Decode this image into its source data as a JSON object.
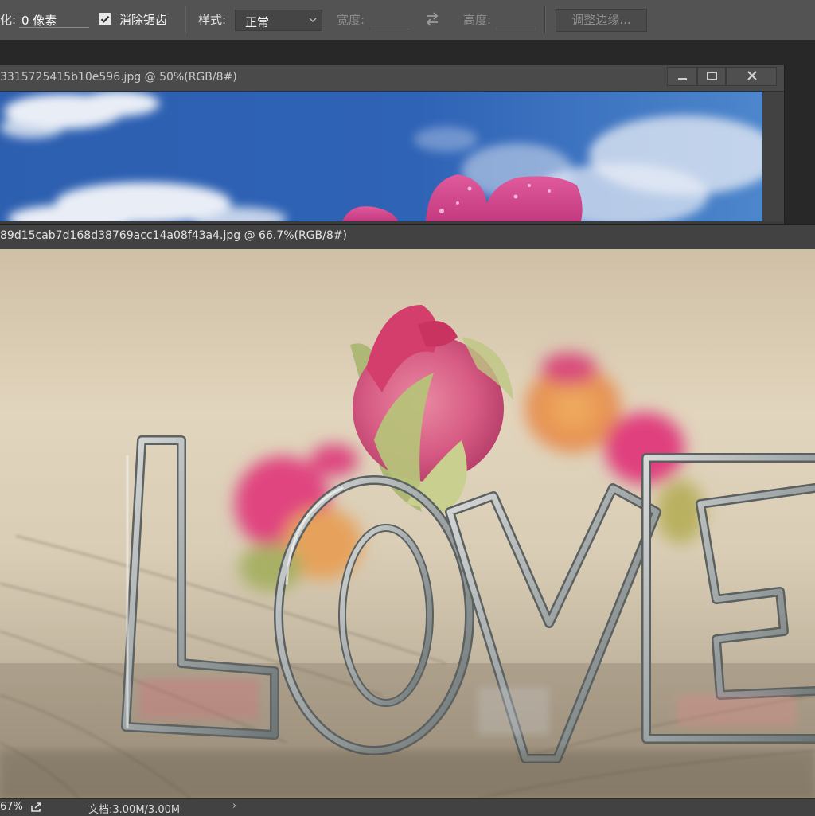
{
  "options_bar": {
    "feather_label": "化:",
    "feather_value": "0 像素",
    "antialias_checked": true,
    "antialias_label": "消除锯齿",
    "style_label": "样式:",
    "style_value": "正常",
    "width_label": "宽度:",
    "height_label": "高度:",
    "refine_edge_label": "调整边缘..."
  },
  "documents": [
    {
      "title": "3315725415b10e596.jpg @ 50%(RGB/8#)",
      "content": "blue sky with clouds and pink flower petals"
    },
    {
      "title": "89d15cab7d168d38769acc14a08f43a4.jpg @ 66.7%(RGB/8#)",
      "content": "metal LOVE letters on wooden surface with rose buds"
    }
  ],
  "status_bar": {
    "zoom": "67%",
    "doc_size": "文档:3.00M/3.00M",
    "arrow": "›"
  },
  "colors": {
    "options_bg": "#535353",
    "workspace_bg": "#282828",
    "title_bg": "#4a4a4a",
    "sky_blue": "#2f66b8",
    "petal_pink": "#d6438a"
  }
}
